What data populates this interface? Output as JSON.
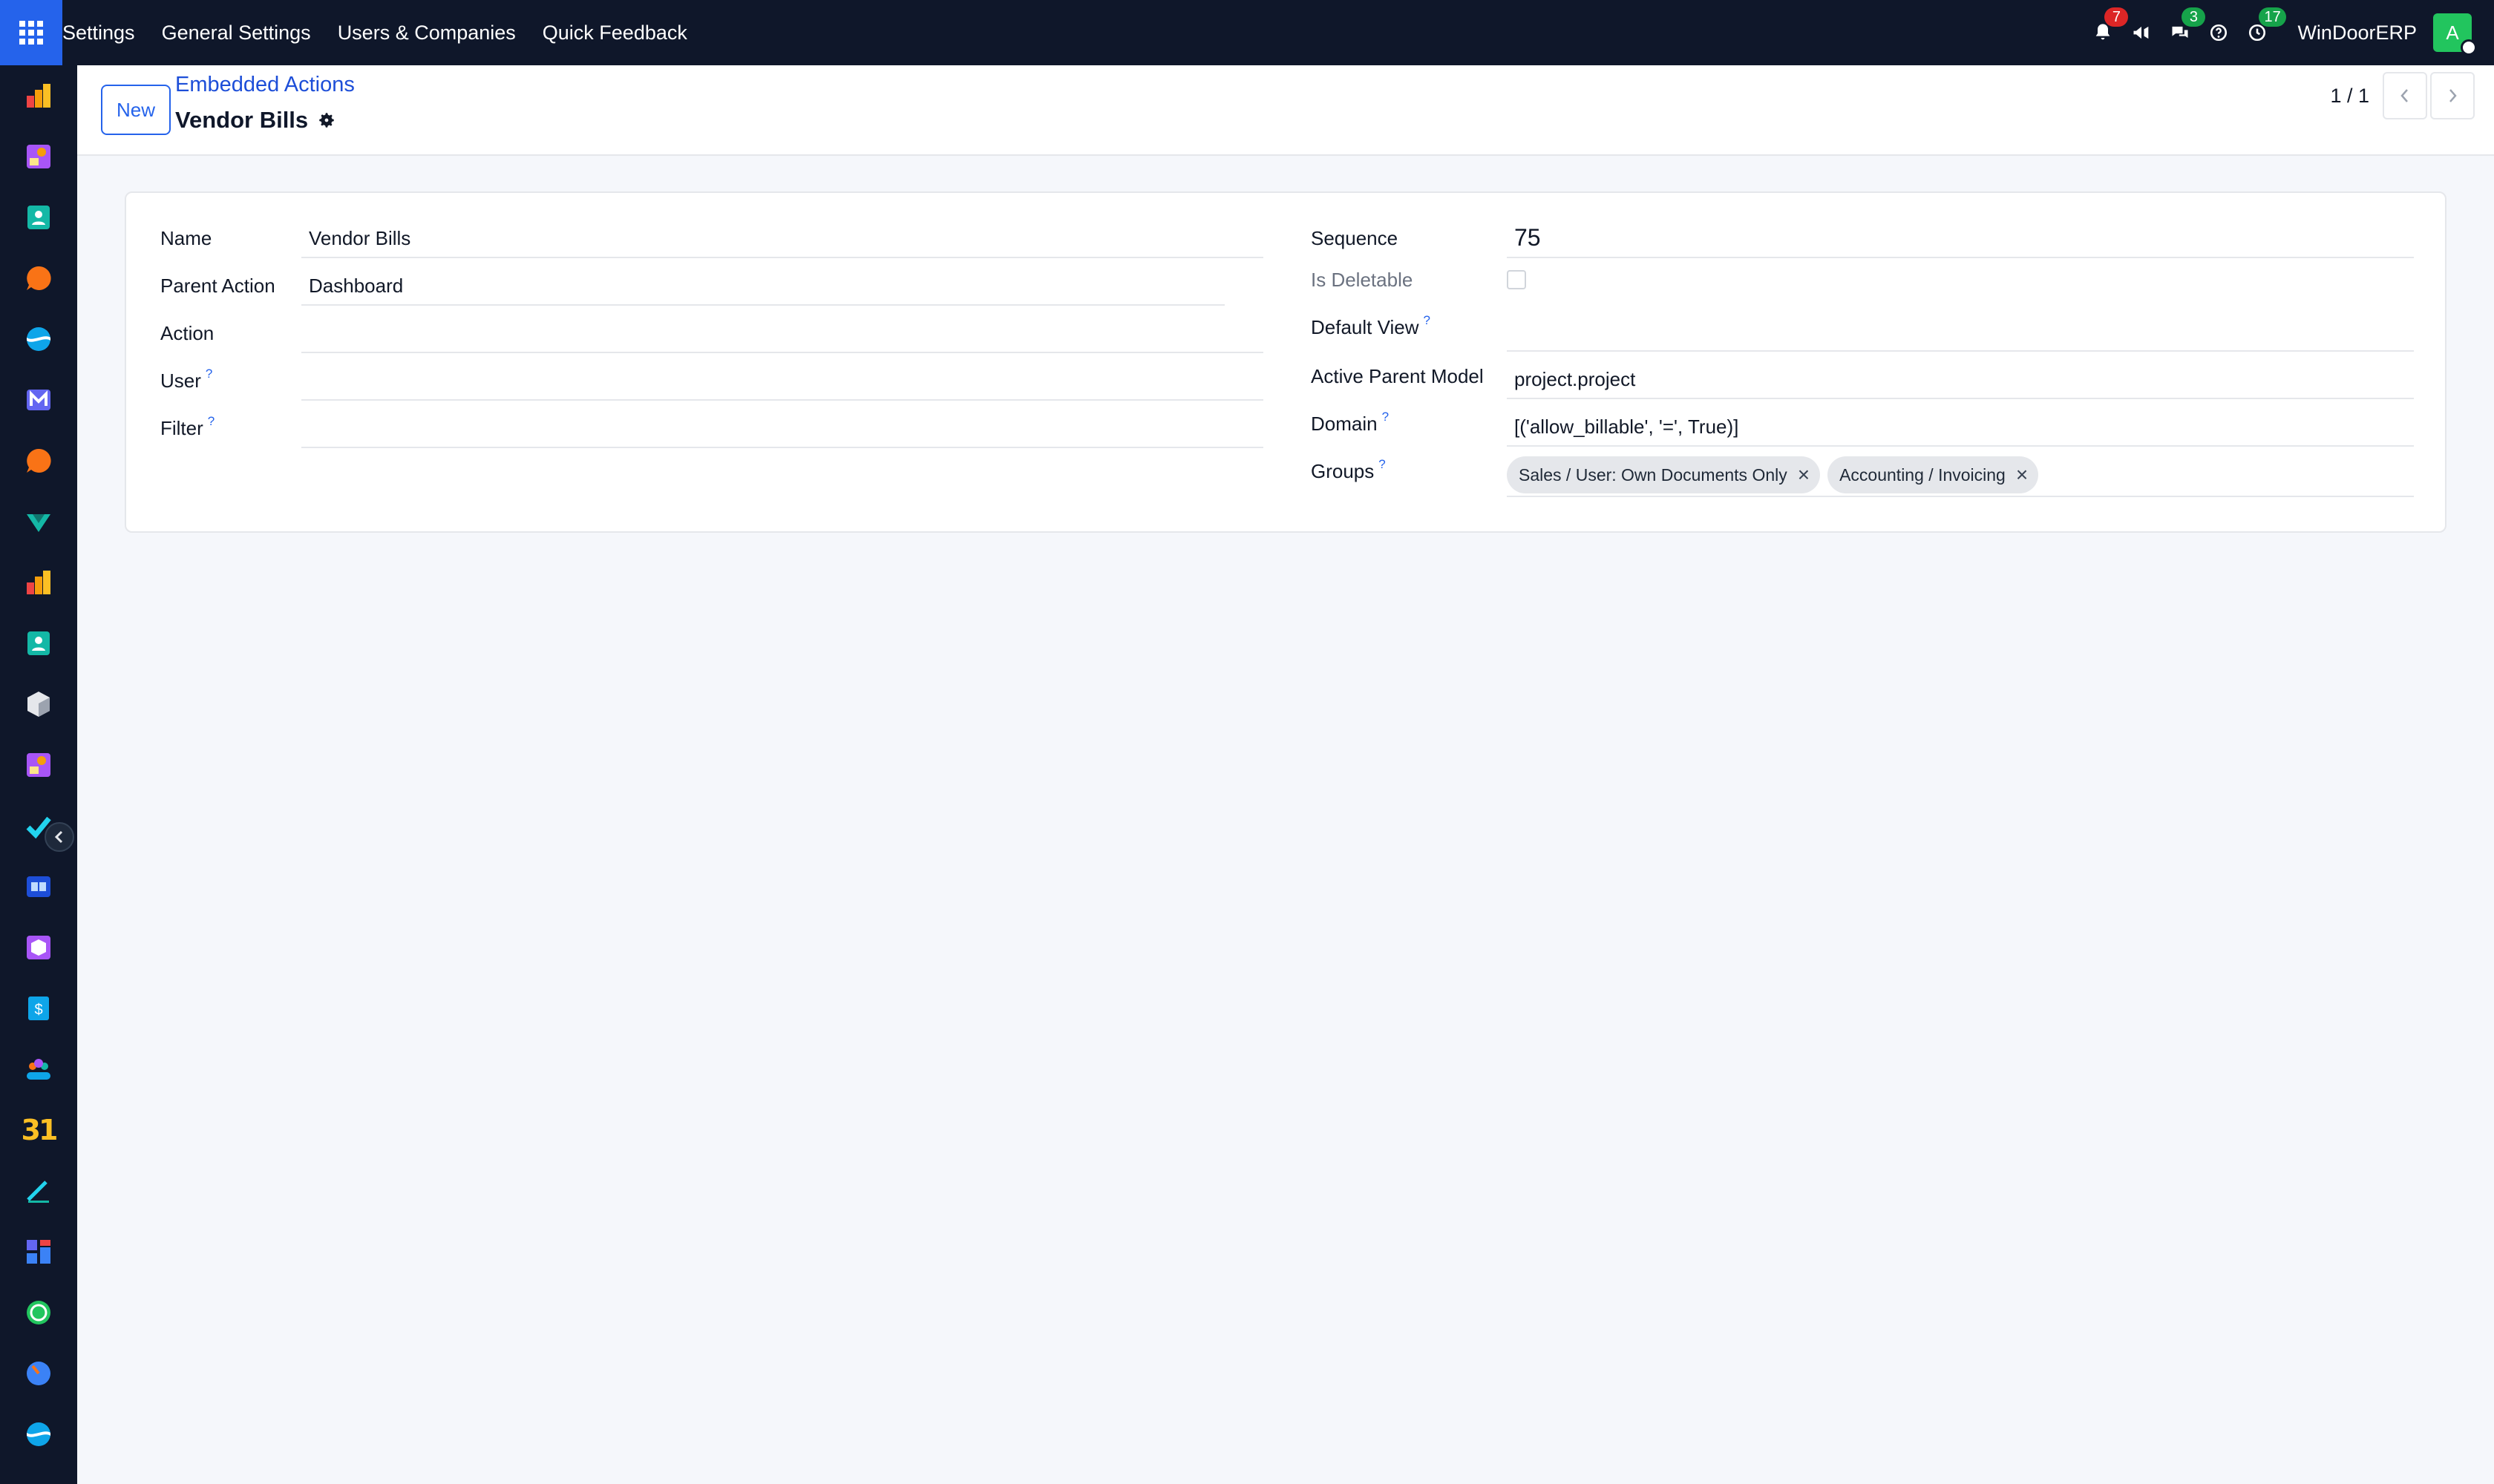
{
  "topbar": {
    "menu": [
      "Settings",
      "General Settings",
      "Users & Companies",
      "Quick Feedback"
    ],
    "notifications_count": "7",
    "messages_count": "3",
    "activities_count": "17",
    "company": "WinDoorERP",
    "avatar_initial": "A"
  },
  "control_panel": {
    "new_label": "New",
    "breadcrumb": "Embedded Actions",
    "record_title": "Vendor Bills",
    "pager": "1 / 1"
  },
  "form": {
    "name_label": "Name",
    "name_value": "Vendor Bills",
    "parent_action_label": "Parent Action",
    "parent_action_value": "Dashboard",
    "action_label": "Action",
    "action_value": "",
    "user_label": "User",
    "user_value": "",
    "filter_label": "Filter",
    "filter_value": "",
    "help_mark": "?",
    "sequence_label": "Sequence",
    "sequence_value": "75",
    "is_deletable_label": "Is Deletable",
    "default_view_label": "Default View",
    "default_view_value": "",
    "active_parent_model_label": "Active Parent Model",
    "active_parent_model_value": "project.project",
    "domain_label": "Domain",
    "domain_value": "[('allow_billable', '=', True)]",
    "groups_label": "Groups",
    "groups": [
      "Sales / User: Own Documents Only",
      "Accounting / Invoicing"
    ]
  },
  "sidebar": {
    "apps": [
      "dashboard-icon",
      "knowledge-icon",
      "contacts-icon",
      "discuss-icon",
      "website-icon",
      "email-marketing-icon",
      "livechat-icon",
      "surveys-icon",
      "reporting-icon",
      "employees-icon",
      "inventory-icon",
      "sign-icon",
      "project-icon",
      "documents-icon",
      "product-icon",
      "invoicing-icon",
      "team-icon",
      "calendar-icon",
      "notes-icon",
      "apps-icon",
      "whatsapp-icon",
      "timesheet-icon",
      "website2-icon"
    ],
    "calendar_text": "31"
  }
}
